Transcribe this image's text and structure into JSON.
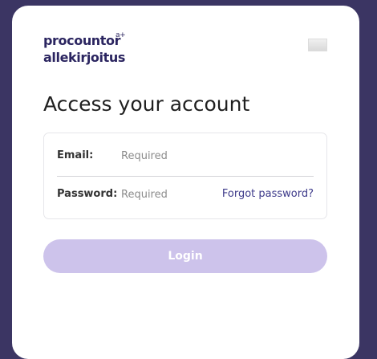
{
  "brand": {
    "logo_line1": "procountor",
    "logo_sup": "a+",
    "logo_line2": "allekirjoitus"
  },
  "page": {
    "title": "Access your account"
  },
  "form": {
    "email_label": "Email:",
    "email_placeholder": "Required",
    "email_value": "",
    "password_label": "Password:",
    "password_placeholder": "Required",
    "password_value": "",
    "forgot_label": "Forgot password?"
  },
  "actions": {
    "login_label": "Login"
  },
  "colors": {
    "background": "#3b3563",
    "brand": "#2b2560",
    "link": "#3d3a8a",
    "button_disabled": "#cdc3eb"
  }
}
